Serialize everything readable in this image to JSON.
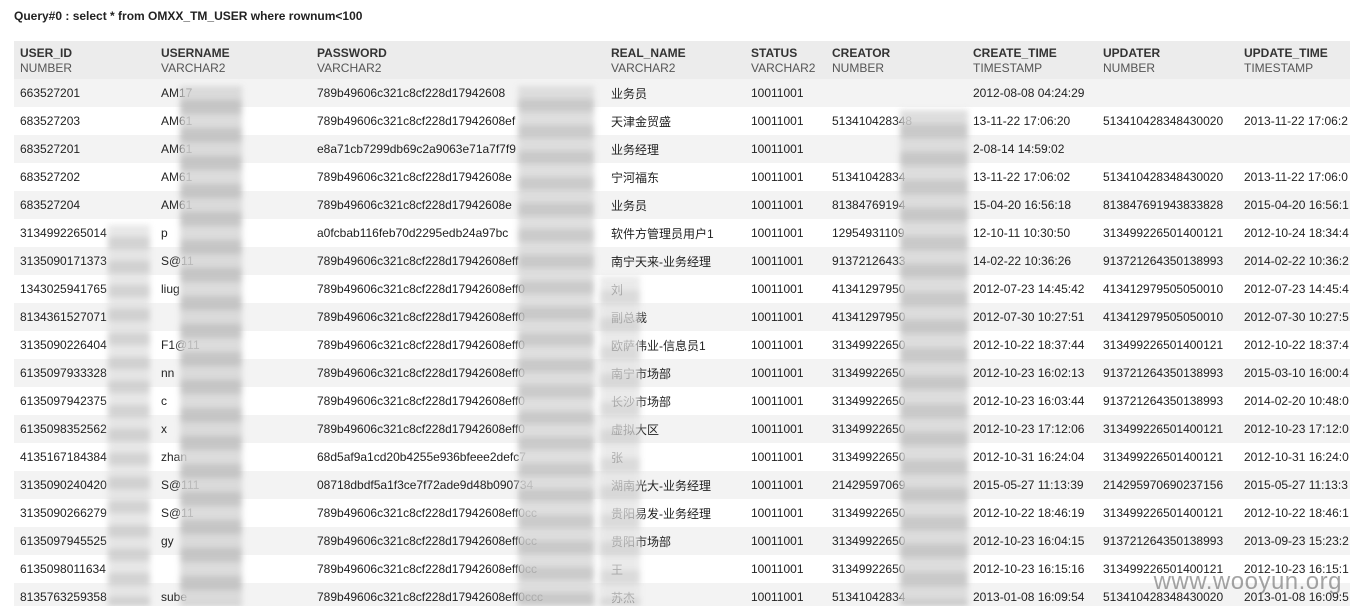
{
  "query_title": "Query#0 : select * from OMXX_TM_USER where rownum<100",
  "columns": [
    {
      "name": "USER_ID",
      "type": "NUMBER"
    },
    {
      "name": "USERNAME",
      "type": "VARCHAR2"
    },
    {
      "name": "PASSWORD",
      "type": "VARCHAR2"
    },
    {
      "name": "REAL_NAME",
      "type": "VARCHAR2"
    },
    {
      "name": "STATUS",
      "type": "VARCHAR2"
    },
    {
      "name": "CREATOR",
      "type": "NUMBER"
    },
    {
      "name": "CREATE_TIME",
      "type": "TIMESTAMP"
    },
    {
      "name": "UPDATER",
      "type": "NUMBER"
    },
    {
      "name": "UPDATE_TIME",
      "type": "TIMESTAMP"
    }
  ],
  "rows": [
    [
      "663527201",
      "AM17",
      "789b49606c321c8cf228d17942608",
      "业务员",
      "10011001",
      "",
      "2012-08-08 04:24:29",
      "",
      ""
    ],
    [
      "683527203",
      "AM61",
      "789b49606c321c8cf228d17942608ef",
      "天津金贸盛",
      "10011001",
      "513410428348",
      "13-11-22 17:06:20",
      "513410428348430020",
      "2013-11-22 17:06:2"
    ],
    [
      "683527201",
      "AM61",
      "e8a71cb7299db69c2a9063e71a7f7f9",
      "业务经理",
      "10011001",
      "",
      "2-08-14 14:59:02",
      "",
      ""
    ],
    [
      "683527202",
      "AM61",
      "789b49606c321c8cf228d17942608e",
      "宁河福东",
      "10011001",
      "51341042834",
      "13-11-22 17:06:02",
      "513410428348430020",
      "2013-11-22 17:06:0"
    ],
    [
      "683527204",
      "AM61",
      "789b49606c321c8cf228d17942608e",
      "业务员",
      "10011001",
      "81384769194",
      "15-04-20 16:56:18",
      "813847691943833828",
      "2015-04-20 16:56:1"
    ],
    [
      "3134992265014",
      "p",
      "a0fcbab116feb70d2295edb24a97bc",
      "软件方管理员用户1",
      "10011001",
      "12954931109",
      "12-10-11 10:30:50",
      "313499226501400121",
      "2012-10-24 18:34:4"
    ],
    [
      "3135090171373",
      "S@11",
      "789b49606c321c8cf228d17942608eff",
      "南宁天来-业务经理",
      "10011001",
      "91372126433",
      "14-02-22 10:36:26",
      "913721264350138993",
      "2014-02-22 10:36:2"
    ],
    [
      "1343025941765",
      "liug",
      "789b49606c321c8cf228d17942608eff0",
      "刘",
      "10011001",
      "41341297950",
      "2012-07-23 14:45:42",
      "413412979505050010",
      "2012-07-23 14:45:4"
    ],
    [
      "8134361527071",
      "",
      "789b49606c321c8cf228d17942608eff0",
      "副总裁",
      "10011001",
      "41341297950",
      "2012-07-30 10:27:51",
      "413412979505050010",
      "2012-07-30 10:27:5"
    ],
    [
      "3135090226404",
      "F1@11",
      "789b49606c321c8cf228d17942608eff0",
      "欧萨伟业-信息员1",
      "10011001",
      "31349922650",
      "2012-10-22 18:37:44",
      "313499226501400121",
      "2012-10-22 18:37:4"
    ],
    [
      "6135097933328",
      "nn",
      "789b49606c321c8cf228d17942608eff0",
      "南宁市场部",
      "10011001",
      "31349922650",
      "2012-10-23 16:02:13",
      "913721264350138993",
      "2015-03-10 16:00:4"
    ],
    [
      "6135097942375",
      "c",
      "789b49606c321c8cf228d17942608eff0",
      "长沙市场部",
      "10011001",
      "31349922650",
      "2012-10-23 16:03:44",
      "913721264350138993",
      "2014-02-20 10:48:0"
    ],
    [
      "6135098352562",
      "x",
      "789b49606c321c8cf228d17942608eff0",
      "虚拟大区",
      "10011001",
      "31349922650",
      "2012-10-23 17:12:06",
      "313499226501400121",
      "2012-10-23 17:12:0"
    ],
    [
      "4135167184384",
      "zhan",
      "68d5af9a1cd20b4255e936bfeee2defc7",
      "张",
      "10011001",
      "31349922650",
      "2012-10-31 16:24:04",
      "313499226501400121",
      "2012-10-31 16:24:0"
    ],
    [
      "3135090240420",
      "S@111",
      "08718dbdf5a1f3ce7f72ade9d48b090734",
      "湖南光大-业务经理",
      "10011001",
      "21429597069",
      "2015-05-27 11:13:39",
      "214295970690237156",
      "2015-05-27 11:13:3"
    ],
    [
      "3135090266279",
      "S@11",
      "789b49606c321c8cf228d17942608eff0cc",
      "贵阳易发-业务经理",
      "10011001",
      "31349922650",
      "2012-10-22 18:46:19",
      "313499226501400121",
      "2012-10-22 18:46:1"
    ],
    [
      "6135097945525",
      "gy",
      "789b49606c321c8cf228d17942608eff0cc",
      "贵阳市场部",
      "10011001",
      "31349922650",
      "2012-10-23 16:04:15",
      "913721264350138993",
      "2013-09-23 15:23:2"
    ],
    [
      "6135098011634",
      "",
      "789b49606c321c8cf228d17942608eff0cc",
      "王",
      "10011001",
      "31349922650",
      "2012-10-23 16:15:16",
      "313499226501400121",
      "2012-10-23 16:15:1"
    ],
    [
      "8135763259358",
      "sube",
      "789b49606c321c8cf228d17942608eff0ccc",
      "苏杰",
      "10011001",
      "51341042834",
      "2013-01-08 16:09:54",
      "513410428348430020",
      "2013-01-08 16:09:5"
    ]
  ],
  "watermark": "www.wooyun.org"
}
